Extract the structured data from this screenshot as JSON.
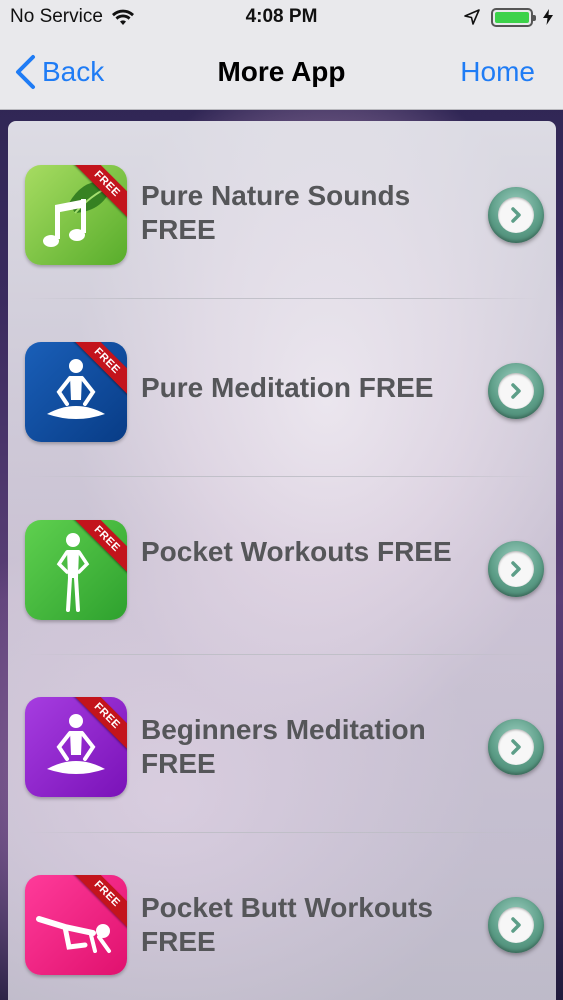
{
  "status_bar": {
    "carrier": "No Service",
    "time": "4:08 PM",
    "battery_level": 1.0
  },
  "nav": {
    "back_label": "Back",
    "title": "More App",
    "home_label": "Home"
  },
  "apps": [
    {
      "name": "Pure Nature Sounds FREE",
      "badge": "FREE",
      "icon": "music-leaf-icon",
      "icon_color": "#7cc443"
    },
    {
      "name": "Pure Meditation FREE",
      "badge": "FREE",
      "icon": "meditation-figure-icon",
      "icon_color": "#0b4ea2"
    },
    {
      "name": "Pocket Workouts FREE",
      "badge": "FREE",
      "icon": "standing-figure-icon",
      "icon_color": "#3cb83c"
    },
    {
      "name": "Beginners Meditation FREE",
      "badge": "FREE",
      "icon": "meditation-figure-icon",
      "icon_color": "#8b1fc7"
    },
    {
      "name": "Pocket Butt Workouts FREE",
      "badge": "FREE",
      "icon": "exercise-figure-icon",
      "icon_color": "#ea1a7f"
    }
  ],
  "colors": {
    "accent": "#1f7cf5",
    "arrow_button": "#5d9e88",
    "ribbon": "#c3141c"
  }
}
